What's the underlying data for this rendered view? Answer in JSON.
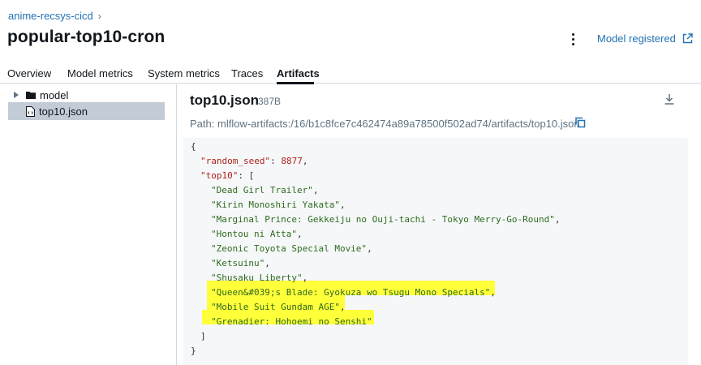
{
  "breadcrumb": {
    "parent": "anime-recsys-cicd",
    "separator": "›"
  },
  "page": {
    "title": "popular-top10-cron"
  },
  "header": {
    "model_registered_label": "Model registered"
  },
  "tabs": [
    {
      "label": "Overview",
      "active": false
    },
    {
      "label": "Model metrics",
      "active": false
    },
    {
      "label": "System metrics",
      "active": false
    },
    {
      "label": "Traces",
      "active": false
    },
    {
      "label": "Artifacts",
      "active": true
    }
  ],
  "tree": [
    {
      "label": "model",
      "type": "folder",
      "expanded": false,
      "selected": false
    },
    {
      "label": "top10.json",
      "type": "file",
      "selected": true
    }
  ],
  "artifact": {
    "name": "top10.json",
    "size": "387B",
    "path_label": "Path:",
    "path": "mlflow-artifacts:/16/b1c8fce7c462474a89a78500f502ad74/artifacts/top10.json"
  },
  "json_view": {
    "open_brace": "{",
    "seed_key": "\"random_seed\"",
    "seed_value": "8877",
    "list_key": "\"top10\"",
    "open_bracket": "[",
    "items": [
      "\"Dead Girl Trailer\"",
      "\"Kirin Monoshiri Yakata\"",
      "\"Marginal Prince: Gekkeiju no Ouji-tachi - Tokyo Merry-Go-Round\"",
      "\"Hontou ni Atta\"",
      "\"Zeonic Toyota Special Movie\"",
      "\"Ketsuinu\"",
      "\"Shusaku Liberty\"",
      "\"Queen&#039;s Blade: Gyokuza wo Tsugu Mono Specials\"",
      "\"Mobile Suit Gundam AGE\"",
      "\"Grenadier: Hohoemi no Senshi\""
    ],
    "close_bracket": "]",
    "close_brace": "}"
  },
  "highlighted_items": [
    7,
    8,
    9
  ],
  "colors": {
    "link": "#2272b4",
    "highlight": "#ffff3a",
    "selected_row": "#c3ccd6",
    "code_bg": "#f5f7f8"
  }
}
